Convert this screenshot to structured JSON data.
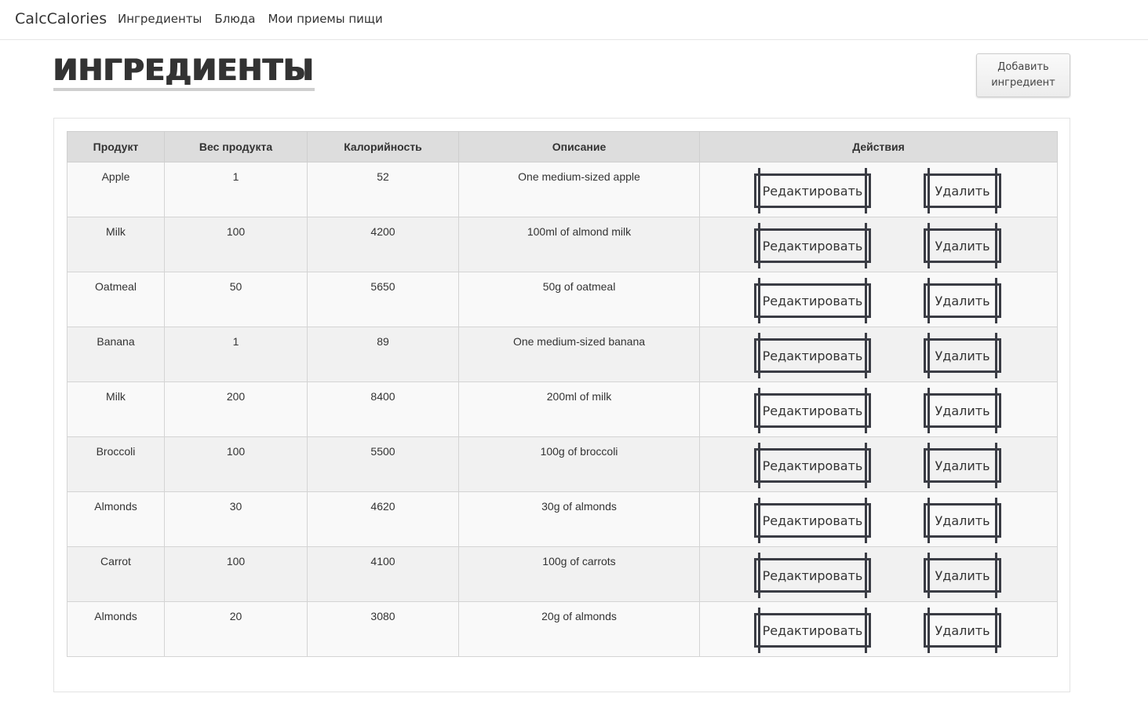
{
  "navbar": {
    "brand": "CalcCalories",
    "links": [
      "Ингредиенты",
      "Блюда",
      "Мои приемы пищи"
    ]
  },
  "page": {
    "title": "ИНГРЕДИЕНТЫ",
    "add_button_label": "Добавить ингредиент"
  },
  "table": {
    "headers": [
      "Продукт",
      "Вес продукта",
      "Калорийность",
      "Описание",
      "Действия"
    ],
    "edit_label": "Редактировать",
    "delete_label": "Удалить",
    "rows": [
      {
        "product": "Apple",
        "weight": "1",
        "calories": "52",
        "description": "One medium-sized apple"
      },
      {
        "product": "Milk",
        "weight": "100",
        "calories": "4200",
        "description": "100ml of almond milk"
      },
      {
        "product": "Oatmeal",
        "weight": "50",
        "calories": "5650",
        "description": "50g of oatmeal"
      },
      {
        "product": "Banana",
        "weight": "1",
        "calories": "89",
        "description": "One medium-sized banana"
      },
      {
        "product": "Milk",
        "weight": "200",
        "calories": "8400",
        "description": "200ml of milk"
      },
      {
        "product": "Broccoli",
        "weight": "100",
        "calories": "5500",
        "description": "100g of broccoli"
      },
      {
        "product": "Almonds",
        "weight": "30",
        "calories": "4620",
        "description": "30g of almonds"
      },
      {
        "product": "Carrot",
        "weight": "100",
        "calories": "4100",
        "description": "100g of carrots"
      },
      {
        "product": "Almonds",
        "weight": "20",
        "calories": "3080",
        "description": "20g of almonds"
      }
    ]
  }
}
